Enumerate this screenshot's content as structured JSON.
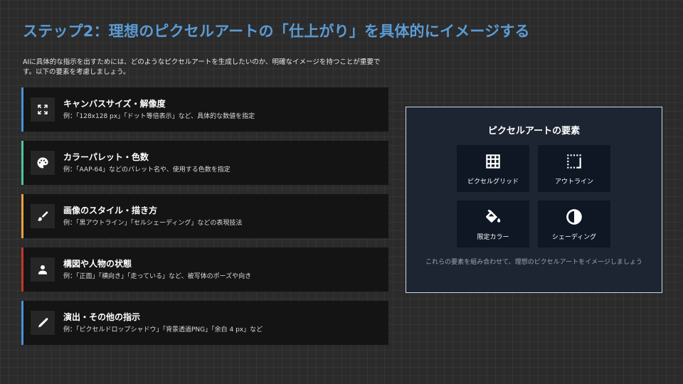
{
  "title": "ステップ2：理想のピクセルアートの「仕上がり」を具体的にイメージする",
  "intro": "AIに具体的な指示を出すためには、どのようなピクセルアートを生成したいのか、明確なイメージを持つことが重要です。以下の要素を考慮しましょう。",
  "cards": [
    {
      "title": "キャンバスサイズ・解像度",
      "desc": "例：「128x128 px」「ドット等倍表示」など、具体的な数値を指定",
      "icon": "expand-icon",
      "accent": "#4a90d9"
    },
    {
      "title": "カラーパレット・色数",
      "desc": "例：「AAP-64」などのパレット名や、使用する色数を指定",
      "icon": "palette-icon",
      "accent": "#4fc3a1"
    },
    {
      "title": "画像のスタイル・描き方",
      "desc": "例：「黒アウトライン」「セルシェーディング」などの表現技法",
      "icon": "brush-icon",
      "accent": "#e5a33b"
    },
    {
      "title": "構図や人物の状態",
      "desc": "例：「正面」「横向き」「走っている」など、被写体のポーズや向き",
      "icon": "person-icon",
      "accent": "#c0392b"
    },
    {
      "title": "演出・その他の指示",
      "desc": "例：「ピクセルドロップシャドウ」「背景透過PNG」「余白 4 px」など",
      "icon": "pen-icon",
      "accent": "#4a90d9"
    }
  ],
  "panel": {
    "title": "ピクセルアートの要素",
    "tiles": [
      {
        "label": "ピクセルグリッド",
        "icon": "grid-icon"
      },
      {
        "label": "アウトライン",
        "icon": "outline-icon"
      },
      {
        "label": "限定カラー",
        "icon": "fill-bucket-icon"
      },
      {
        "label": "シェーディング",
        "icon": "contrast-icon"
      }
    ],
    "footer": "これらの要素を組み合わせて、理想のピクセルアートをイメージしましょう"
  }
}
